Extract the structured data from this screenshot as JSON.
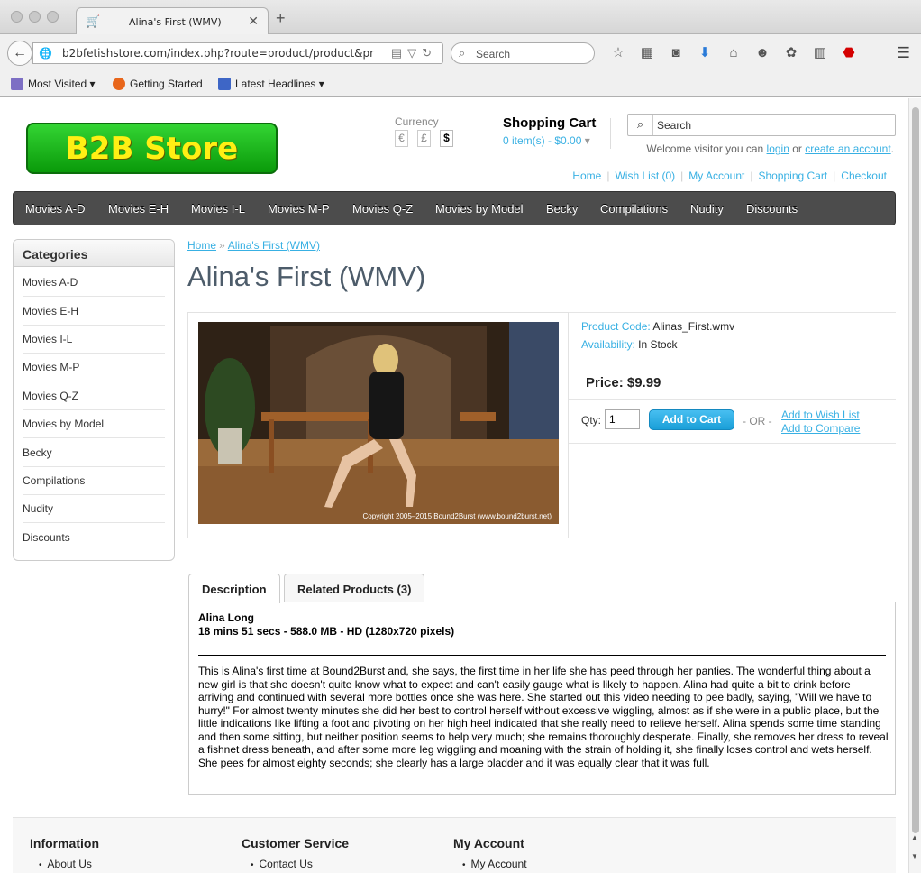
{
  "browser": {
    "tab_title": "Alina's First (WMV)",
    "new_tab": "+",
    "url": "b2bfetishstore.com/index.php?route=product/product&pr",
    "search_placeholder": "Search",
    "bookmarks": [
      {
        "label": "Most Visited",
        "icon": "folder-icon"
      },
      {
        "label": "Getting Started",
        "icon": "firefox-icon"
      },
      {
        "label": "Latest Headlines",
        "icon": "rss-icon"
      }
    ]
  },
  "header": {
    "logo_text": "B2B Store",
    "currency_label": "Currency",
    "currencies": [
      "€",
      "£",
      "$"
    ],
    "active_currency": "$",
    "cart_title": "Shopping Cart",
    "cart_items": "0 item(s) - $0.00",
    "search_placeholder": "Search",
    "welcome_prefix": "Welcome visitor you can",
    "login": "login",
    "or": "or",
    "create_account": "create an account",
    "welcome_suffix": ".",
    "links": [
      "Home",
      "Wish List (0)",
      "My Account",
      "Shopping Cart",
      "Checkout"
    ]
  },
  "menu": [
    "Movies A-D",
    "Movies E-H",
    "Movies I-L",
    "Movies M-P",
    "Movies Q-Z",
    "Movies by Model",
    "Becky",
    "Compilations",
    "Nudity",
    "Discounts"
  ],
  "sidebar": {
    "title": "Categories",
    "items": [
      "Movies A-D",
      "Movies E-H",
      "Movies I-L",
      "Movies M-P",
      "Movies Q-Z",
      "Movies by Model",
      "Becky",
      "Compilations",
      "Nudity",
      "Discounts"
    ]
  },
  "breadcrumb": {
    "home": "Home",
    "sep": "»",
    "current": "Alina's First (WMV)"
  },
  "product": {
    "title": "Alina's First (WMV)",
    "image_copyright": "Copyright 2005–2015 Bound2Burst (www.bound2burst.net)",
    "code_label": "Product Code:",
    "code": "Alinas_First.wmv",
    "availability_label": "Availability:",
    "availability": "In Stock",
    "price": "Price: $9.99",
    "qty_label": "Qty:",
    "qty_value": "1",
    "add_to_cart": "Add to Cart",
    "or_text": "- OR -",
    "add_wishlist": "Add to Wish List",
    "add_compare": "Add to Compare"
  },
  "tabs": [
    {
      "label": "Description",
      "active": true
    },
    {
      "label": "Related Products (3)",
      "active": false
    }
  ],
  "description": {
    "name": "Alina Long",
    "meta": "18 mins 51 secs - 588.0 MB - HD (1280x720 pixels)",
    "text": "This is Alina's first time at Bound2Burst and, she says, the first time in her life she has peed through her panties. The wonderful thing about a new girl is that she doesn't quite know what to expect and can't easily gauge what is likely to happen. Alina had quite a bit to drink before arriving and continued with several more bottles once she was here. She started out this video needing to pee badly, saying, \"Will we have to hurry!\" For almost twenty minutes she did her best to control herself without excessive wiggling, almost as if she were in a public place, but the little indications like lifting a foot and pivoting on her high heel indicated that she really need to relieve herself. Alina spends some time standing and then some sitting, but neither position seems to help very much; she remains thoroughly desperate. Finally, she removes her dress to reveal a fishnet dress beneath, and after some more leg wiggling and moaning with the strain of holding it, she finally loses control and wets herself. She pees for almost eighty seconds; she clearly has a large bladder and it was equally clear that it was full."
  },
  "footer": {
    "columns": [
      {
        "title": "Information",
        "first": "About Us"
      },
      {
        "title": "Customer Service",
        "first": "Contact Us"
      },
      {
        "title": "My Account",
        "first": "My Account"
      }
    ]
  },
  "colors": {
    "link": "#38b0e3",
    "menu_bg": "#4c4c4c",
    "logo_green": "#18b418",
    "logo_text": "#ffef14"
  }
}
